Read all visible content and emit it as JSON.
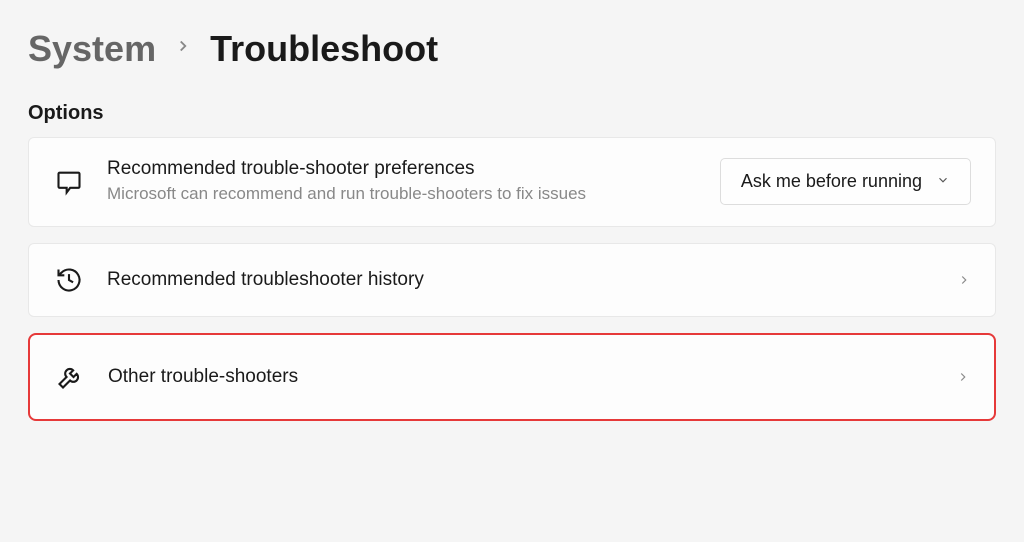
{
  "breadcrumb": {
    "parent": "System",
    "current": "Troubleshoot"
  },
  "section_title": "Options",
  "preferences": {
    "title": "Recommended trouble-shooter preferences",
    "description": "Microsoft can recommend and run trouble-shooters to fix issues",
    "dropdown_value": "Ask me before running"
  },
  "history": {
    "title": "Recommended troubleshooter history"
  },
  "other": {
    "title": "Other trouble-shooters"
  }
}
